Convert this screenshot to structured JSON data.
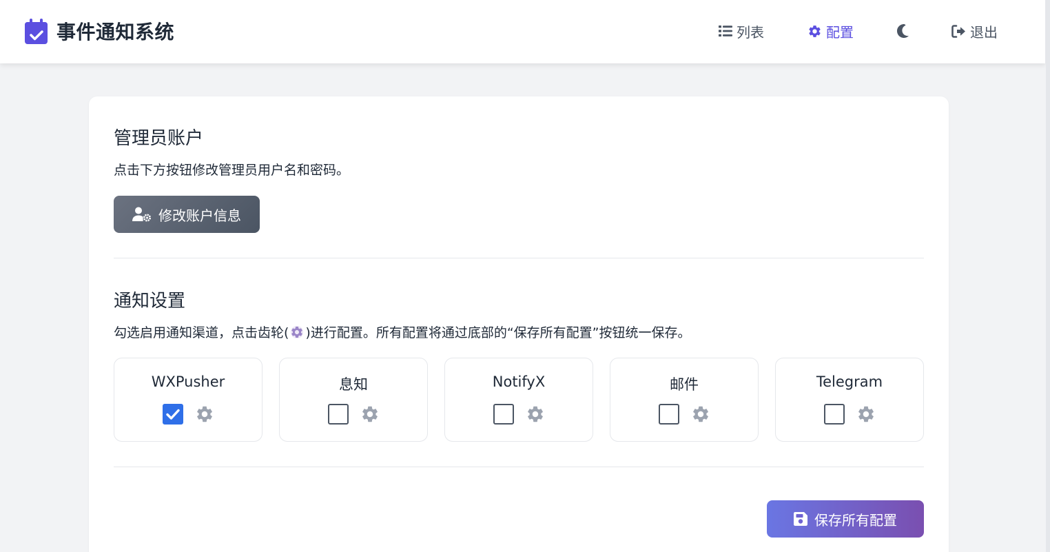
{
  "app": {
    "title": "事件通知系统",
    "brand_icon": "calendar-check-icon",
    "accent_color": "#5b4fe0"
  },
  "nav": {
    "list_label": "列表",
    "list_icon": "list-icon",
    "config_label": "配置",
    "config_icon": "gear-icon",
    "theme_icon": "moon-icon",
    "logout_label": "退出",
    "logout_icon": "sign-out-icon"
  },
  "admin": {
    "title": "管理员账户",
    "description": "点击下方按钮修改管理员用户名和密码。",
    "button_label": "修改账户信息",
    "button_icon": "user-gear-icon"
  },
  "notify": {
    "title": "通知设置",
    "description_before": "勾选启用通知渠道，点击齿轮(",
    "description_after": ")进行配置。所有配置将通过底部的“保存所有配置”按钮统一保存。",
    "channels": [
      {
        "name": "WXPusher",
        "enabled": true
      },
      {
        "name": "息知",
        "enabled": false
      },
      {
        "name": "NotifyX",
        "enabled": false
      },
      {
        "name": "邮件",
        "enabled": false
      },
      {
        "name": "Telegram",
        "enabled": false
      }
    ]
  },
  "save_button": {
    "label": "保存所有配置",
    "icon": "floppy-disk-icon"
  }
}
